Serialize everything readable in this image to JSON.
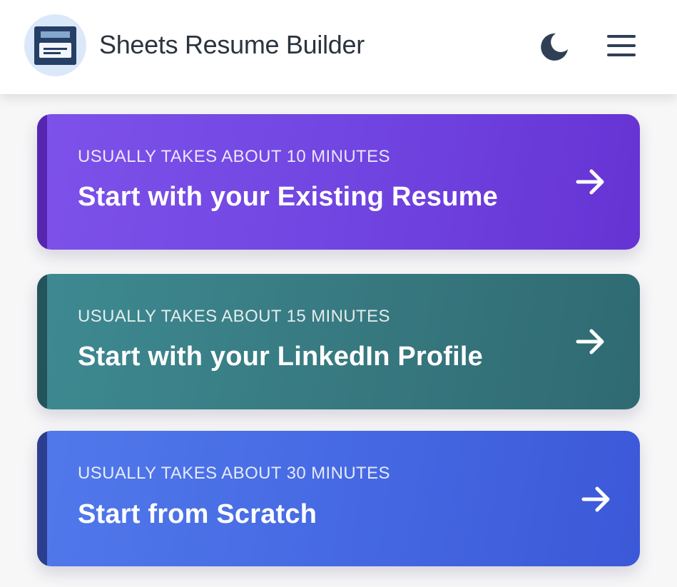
{
  "header": {
    "title": "Sheets Resume Builder",
    "logo_icon": "document-card-icon",
    "theme_toggle_icon": "moon-icon",
    "menu_icon": "hamburger-menu-icon"
  },
  "cards": [
    {
      "eyebrow": "USUALLY TAKES ABOUT 10 MINUTES",
      "title": "Start with your Existing Resume",
      "icon": "arrow-right-icon",
      "color": "#7044e0"
    },
    {
      "eyebrow": "USUALLY TAKES ABOUT 15 MINUTES",
      "title": "Start with your LinkedIn Profile",
      "icon": "arrow-right-icon",
      "color": "#37787f"
    },
    {
      "eyebrow": "USUALLY TAKES ABOUT 30 MINUTES",
      "title": "Start from Scratch",
      "icon": "arrow-right-icon",
      "color": "#4568e2"
    }
  ],
  "colors": {
    "header_bg": "#ffffff",
    "logo_bg": "#dbe8fa",
    "logo_dark": "#263f66",
    "title_text": "#2c3340",
    "icon_dark": "#2f3f55"
  }
}
